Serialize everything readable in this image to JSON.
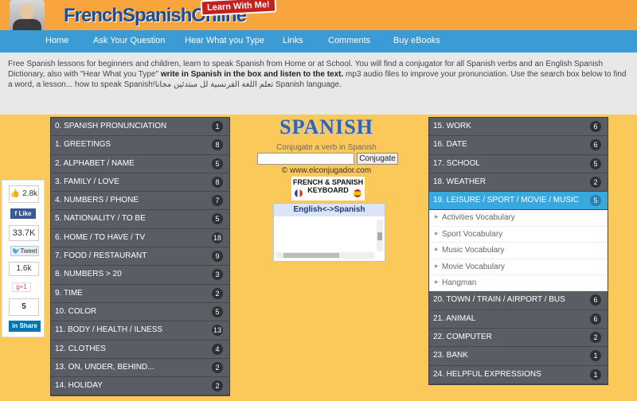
{
  "header": {
    "logo": "FrenchSpanishOnline",
    "badge": "Learn With Me!"
  },
  "nav": [
    "Home",
    "Ask Your Question",
    "Hear What you Type",
    "Links",
    "Comments",
    "Buy eBooks"
  ],
  "intro": {
    "text1": "Free Spanish lessons for beginners and children, learn to speak Spanish from Home or at School. You will find a conjugator for all Spanish verbs and an English Spanish Dictionary, also with \"Hear What you Type\" ",
    "bold": "write in Spanish in the box and listen to the text.",
    "text2": " mp3 audio files to improve your pronunciation. Use the search box below to find a word, a lesson... how to speak Spanish!تعلم اللغة الفرنسية لل مبتدئين مجانا Spanish language."
  },
  "social": {
    "fb_count": "2.8k",
    "fb_like": "Like",
    "tw_count": "33.7K",
    "tw_label": "Tweet",
    "gp_count": "1.6k",
    "gp_label": "g+1",
    "in_count": "5",
    "in_label": "Share"
  },
  "left_list": [
    {
      "label": "0. SPANISH PRONUNCIATION",
      "count": "1"
    },
    {
      "label": "1. GREETINGS",
      "count": "8"
    },
    {
      "label": "2. ALPHABET / NAME",
      "count": "5"
    },
    {
      "label": "3. FAMILY / LOVE",
      "count": "8"
    },
    {
      "label": "4. NUMBERS / PHONE",
      "count": "7"
    },
    {
      "label": "5. NATIONALITY / TO BE",
      "count": "5"
    },
    {
      "label": "6. HOME / TO HAVE / TV",
      "count": "18"
    },
    {
      "label": "7. FOOD / RESTAURANT",
      "count": "9"
    },
    {
      "label": "8. NUMBERS > 20",
      "count": "3"
    },
    {
      "label": "9. TIME",
      "count": "2"
    },
    {
      "label": "10. COLOR",
      "count": "5"
    },
    {
      "label": "11. BODY / HEALTH / ILNESS",
      "count": "13"
    },
    {
      "label": "12. CLOTHES",
      "count": "4"
    },
    {
      "label": "13. ON, UNDER, BEHIND...",
      "count": "2"
    },
    {
      "label": "14. HOLIDAY",
      "count": "2"
    }
  ],
  "right_list_top": [
    {
      "label": "15. WORK",
      "count": "6"
    },
    {
      "label": "16. DATE",
      "count": "6"
    },
    {
      "label": "17. SCHOOL",
      "count": "5"
    },
    {
      "label": "18. WEATHER",
      "count": "2"
    }
  ],
  "right_active": {
    "label": "19. LEISURE / SPORT / MOVIE / MUSIC",
    "count": "5"
  },
  "right_sub": [
    "Activities Vocabulary",
    "Sport Vocabulary",
    "Music Vocabulary",
    "Movie Vocabulary",
    "Hangman"
  ],
  "right_list_bottom": [
    {
      "label": "20. TOWN / TRAIN / AIRPORT / BUS",
      "count": "6"
    },
    {
      "label": "21. ANIMAL",
      "count": "6"
    },
    {
      "label": "22. COMPUTER",
      "count": "2"
    },
    {
      "label": "23. BANK",
      "count": "1"
    },
    {
      "label": "24. HELPFUL EXPRESSIONS",
      "count": "1"
    }
  ],
  "center": {
    "title": "SPANISH",
    "conj_label": "Conjugate a verb in Spanish",
    "conj_button": "Conjugate",
    "copyright": "© www.elconjugador.com",
    "keyboard_line1": "FRENCH & SPANISH",
    "keyboard_line2": "KEYBOARD",
    "dict_title": "English<->Spanish"
  }
}
